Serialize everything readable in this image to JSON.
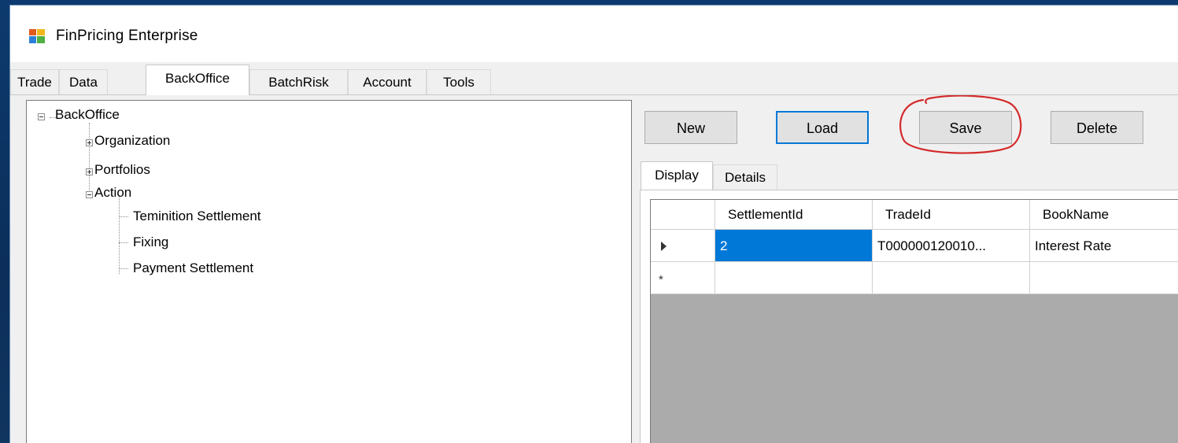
{
  "window": {
    "title": "FinPricing Enterprise"
  },
  "main_tabs": [
    {
      "label": "Trade",
      "active": false
    },
    {
      "label": "Data",
      "active": false
    },
    {
      "label": "BackOffice",
      "active": true
    },
    {
      "label": "BatchRisk",
      "active": false
    },
    {
      "label": "Account",
      "active": false
    },
    {
      "label": "Tools",
      "active": false
    }
  ],
  "tree": {
    "root": {
      "label": "BackOffice",
      "expanded": true
    },
    "children": [
      {
        "label": "Organization",
        "expanded": false
      },
      {
        "label": "Portfolios",
        "expanded": false
      },
      {
        "label": "Action",
        "expanded": true,
        "children": [
          {
            "label": "Teminition Settlement"
          },
          {
            "label": "Fixing"
          },
          {
            "label": "Payment Settlement"
          }
        ]
      }
    ]
  },
  "toolbar": {
    "new_label": "New",
    "load_label": "Load",
    "save_label": "Save",
    "delete_label": "Delete",
    "focused": "Load",
    "annotation": "Save",
    "annotation_color": "#d42a2a"
  },
  "sub_tabs": [
    {
      "label": "Display",
      "active": true
    },
    {
      "label": "Details",
      "active": false
    }
  ],
  "grid": {
    "columns": [
      "SettlementId",
      "TradeId",
      "BookName"
    ],
    "rows": [
      {
        "indicator": "current-row",
        "cells": [
          "2",
          "T000000120010...",
          "Interest Rate"
        ],
        "selected_cell": 0
      },
      {
        "indicator": "new-row",
        "cells": [
          "",
          "",
          ""
        ]
      }
    ],
    "selection_color": "#0078d7"
  },
  "icons": {
    "app": "app-window-icon",
    "current_row": "row-pointer-icon",
    "new_row": "new-row-asterisk-icon"
  }
}
